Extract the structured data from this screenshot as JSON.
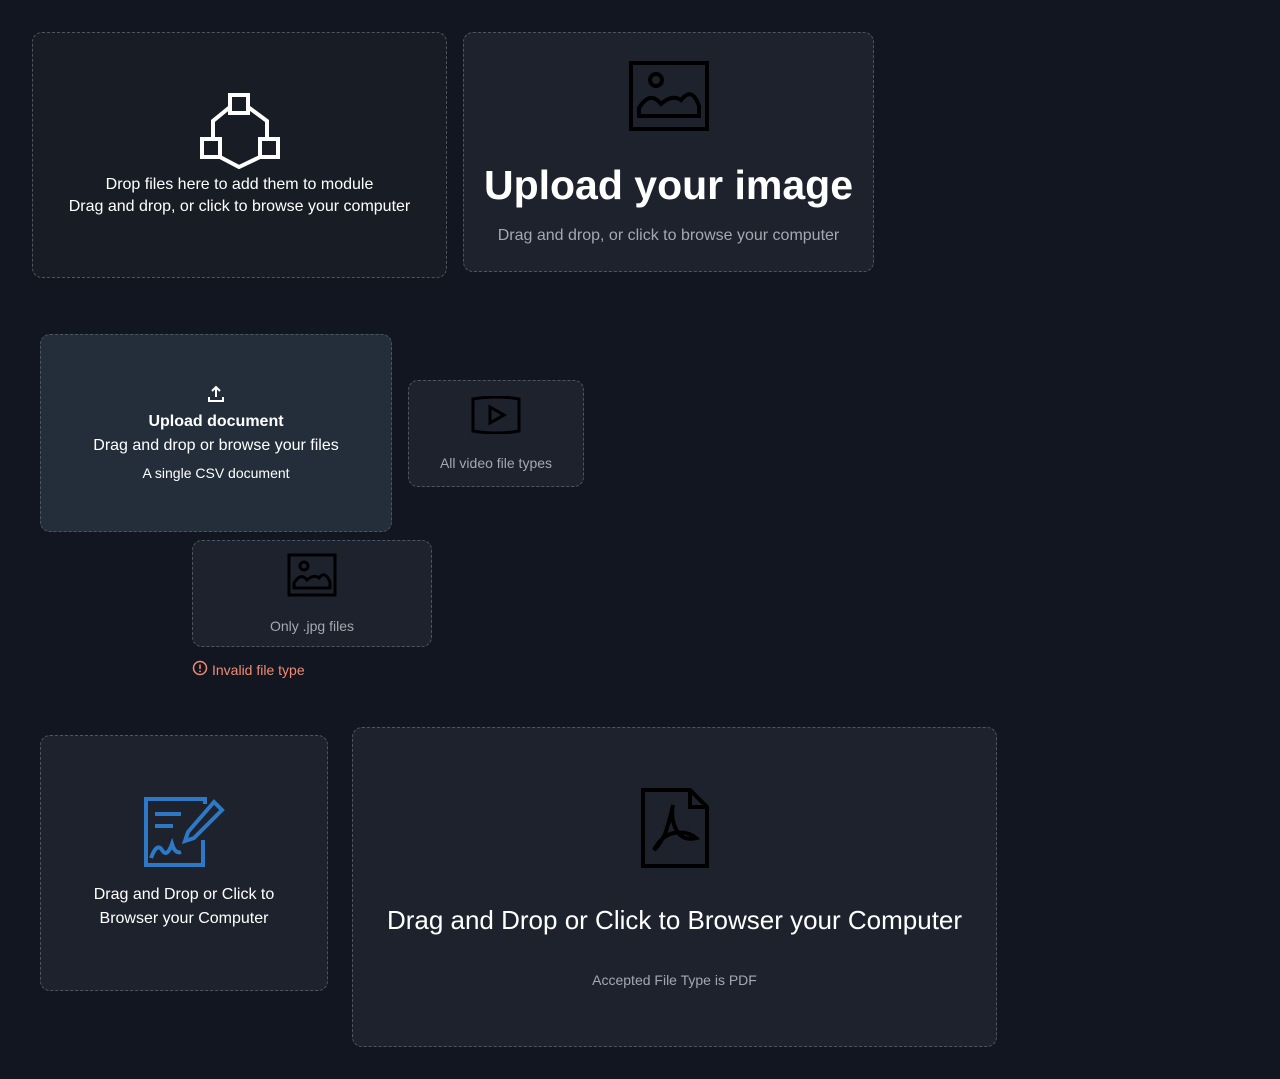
{
  "module_dropzone": {
    "line1": "Drop files here to add them to module",
    "line2": "Drag and drop, or click to browse your computer",
    "icon": "network-nodes-icon"
  },
  "image_dropzone": {
    "title": "Upload your image",
    "subtitle": "Drag and drop, or click to browse your computer",
    "icon": "image-icon"
  },
  "document_dropzone": {
    "title": "Upload document",
    "subtitle": "Drag and drop or browse your files",
    "note": "A single CSV document",
    "icon": "upload-icon"
  },
  "video_dropzone": {
    "note": "All video file types",
    "icon": "video-play-icon"
  },
  "jpg_dropzone": {
    "note": "Only .jpg files",
    "icon": "image-icon",
    "error": "Invalid file type",
    "error_icon": "warning-circle-icon"
  },
  "signature_dropzone": {
    "text": "Drag and Drop or Click to Browser your Computer",
    "icon": "signature-document-icon",
    "icon_color": "#2d79c7"
  },
  "pdf_dropzone": {
    "title": "Drag and Drop or Click to Browser your Computer",
    "note": "Accepted File Type is PDF",
    "icon": "pdf-file-icon"
  },
  "colors": {
    "background": "#111620",
    "panel": "#1d222c",
    "document_panel": "#232e3a",
    "error": "#f28b74",
    "muted_text": "#a3a8b1"
  }
}
